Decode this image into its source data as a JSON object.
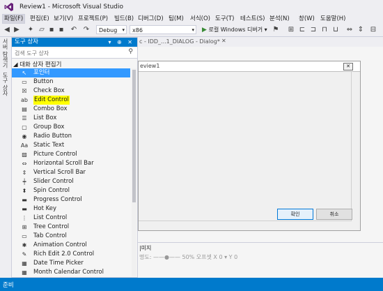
{
  "window": {
    "title": "Review1 - Microsoft Visual Studio"
  },
  "menu": [
    {
      "label": "파일(F)",
      "active": true
    },
    {
      "label": "편집(E)"
    },
    {
      "label": "보기(V)"
    },
    {
      "label": "프로젝트(P)"
    },
    {
      "label": "빌드(B)"
    },
    {
      "label": "디버그(D)"
    },
    {
      "label": "팀(M)"
    },
    {
      "label": "서식(O)"
    },
    {
      "label": "도구(T)"
    },
    {
      "label": "테스트(S)"
    },
    {
      "label": "분석(N)"
    },
    {
      "label": "창(W)"
    },
    {
      "label": "도움말(H)"
    }
  ],
  "toolbar": {
    "config": "Debug",
    "platform": "x86",
    "run_label": "로컬 Windows 디버거"
  },
  "vertical_tabs": [
    "서버 탐색기",
    "도구 상자"
  ],
  "toolbox": {
    "title": "도구 상자",
    "header_buttons": "▾ ⊕ ✕",
    "search_placeholder": "검색 도구 상자",
    "group": "◢ 대화 상자 편집기",
    "items": [
      {
        "icon": "↖",
        "label": "포인터",
        "selected": true
      },
      {
        "icon": "▭",
        "label": "Button"
      },
      {
        "icon": "☒",
        "label": "Check Box"
      },
      {
        "icon": "ab",
        "label": "Edit Control",
        "highlighted": true
      },
      {
        "icon": "▤",
        "label": "Combo Box"
      },
      {
        "icon": "☰",
        "label": "List Box"
      },
      {
        "icon": "▢",
        "label": "Group Box"
      },
      {
        "icon": "◉",
        "label": "Radio Button"
      },
      {
        "icon": "Aa",
        "label": "Static Text"
      },
      {
        "icon": "▨",
        "label": "Picture Control"
      },
      {
        "icon": "⇔",
        "label": "Horizontal Scroll Bar"
      },
      {
        "icon": "⇕",
        "label": "Vertical Scroll Bar"
      },
      {
        "icon": "┿",
        "label": "Slider Control"
      },
      {
        "icon": "⬍",
        "label": "Spin Control"
      },
      {
        "icon": "▬",
        "label": "Progress Control"
      },
      {
        "icon": "▬",
        "label": "Hot Key"
      },
      {
        "icon": "⋮",
        "label": "List Control"
      },
      {
        "icon": "⊞",
        "label": "Tree Control"
      },
      {
        "icon": "▭",
        "label": "Tab Control"
      },
      {
        "icon": "✱",
        "label": "Animation Control"
      },
      {
        "icon": "✎",
        "label": "Rich Edit 2.0 Control"
      },
      {
        "icon": "▦",
        "label": "Date Time Picker"
      },
      {
        "icon": "▦",
        "label": "Month Calendar Control"
      }
    ]
  },
  "document": {
    "tab_label": "c - IDD_...1_DIALOG - Dialog*",
    "tab_close": "✕",
    "dialog_title": "eview1",
    "ok_label": "확인",
    "cancel_label": "취소"
  },
  "properties": {
    "title": "|미지",
    "row": "명도: ——●——  50%  오프셋 X  0  ▾  Y  0"
  },
  "status": {
    "text": "준비"
  },
  "colors": {
    "accent": "#007ACC",
    "selection": "#3399FF",
    "highlight": "#FFFF00"
  }
}
